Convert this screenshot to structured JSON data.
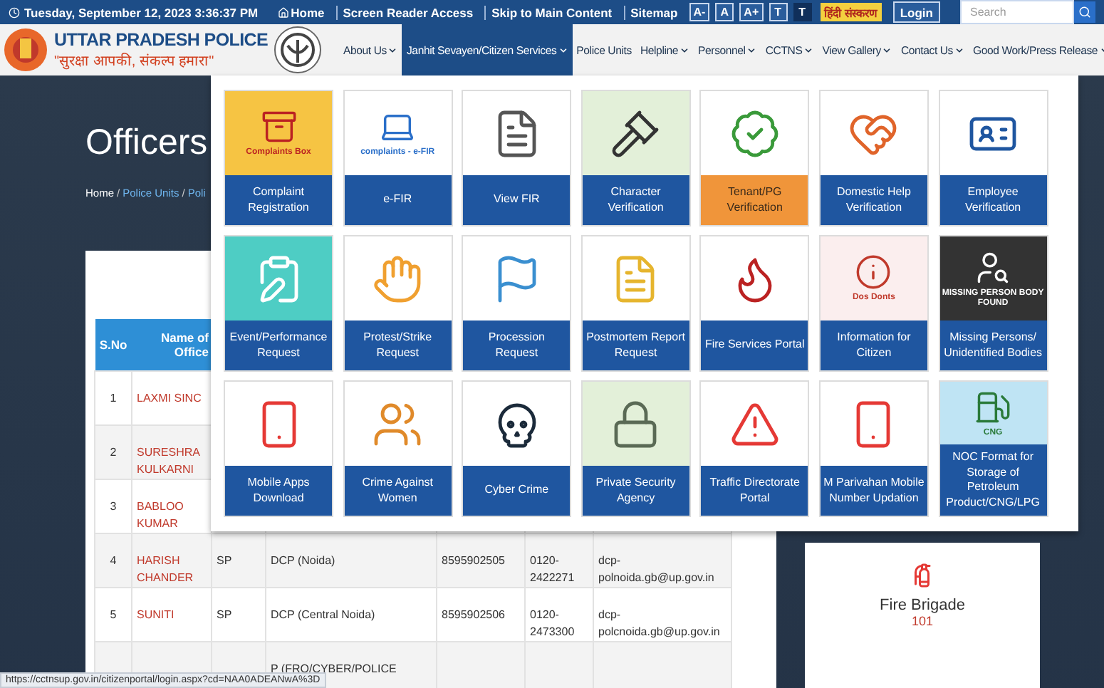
{
  "top_bar": {
    "datetime": "Tuesday, September 12, 2023 3:36:37 PM",
    "links": [
      {
        "label": "Home",
        "kind": "home"
      },
      {
        "label": "Screen Reader Access",
        "kind": "link"
      },
      {
        "label": "Skip to Main Content",
        "kind": "link"
      },
      {
        "label": "Sitemap",
        "kind": "link"
      }
    ],
    "font_buttons": [
      {
        "label": "A-",
        "selected": false
      },
      {
        "label": "A",
        "selected": false
      },
      {
        "label": "A+",
        "selected": false
      },
      {
        "label": "T",
        "selected": false
      },
      {
        "label": "T",
        "selected": true
      }
    ],
    "language_button": "हिंदी संस्करण",
    "login_button": "Login",
    "search": {
      "placeholder": "Search"
    }
  },
  "header": {
    "title": "UTTAR PRADESH POLICE",
    "slogan": "\"सुरक्षा आपकी, संकल्प हमारा\"",
    "nav": [
      {
        "label": "About Us",
        "dropdown": true,
        "selected": false
      },
      {
        "label": "Janhit Sevayen/Citizen Services",
        "dropdown": true,
        "selected": true
      },
      {
        "label": "Police Units",
        "dropdown": false,
        "selected": false
      },
      {
        "label": "Helpline",
        "dropdown": true,
        "selected": false
      },
      {
        "label": "Personnel",
        "dropdown": true,
        "selected": false
      },
      {
        "label": "CCTNS",
        "dropdown": true,
        "selected": false
      },
      {
        "label": "View Gallery",
        "dropdown": true,
        "selected": false
      },
      {
        "label": "Contact Us",
        "dropdown": true,
        "selected": false
      },
      {
        "label": "Good Work/Press Release",
        "dropdown": true,
        "selected": false
      }
    ]
  },
  "page": {
    "heading": "Officers",
    "breadcrumb": {
      "separator": "/",
      "items": [
        "Home",
        "Police Units",
        "Poli"
      ]
    },
    "table": {
      "columns": [
        "S.No",
        "Name of Office"
      ],
      "rows": [
        {
          "cells": [
            "1",
            "LAXMI SINC"
          ]
        },
        {
          "cells": [
            "2",
            "SURESHRA KULKARNI"
          ]
        },
        {
          "cells": [
            "3",
            "BABLOO KUMAR"
          ]
        },
        {
          "cells": [
            "4",
            "HARISH CHANDER",
            "SP",
            "DCP (Noida)",
            "8595902505",
            "0120-2422271",
            "dcp-polnoida.gb@up.gov.in"
          ]
        },
        {
          "cells": [
            "5",
            "SUNITI",
            "SP",
            "DCP (Central Noida)",
            "8595902506",
            "0120-2473300",
            "dcp-polcnoida.gb@up.gov.in"
          ]
        },
        {
          "cells": [
            "",
            "",
            "",
            "P (FRO/CYBER/POLICE"
          ]
        }
      ]
    },
    "helpline_card": {
      "title": "Fire Brigade",
      "number": "101"
    }
  },
  "dropdown_menu": {
    "tiles": [
      {
        "label": "Complaint Registration",
        "hovered": false,
        "picture_text": "Complaints Box"
      },
      {
        "label": "e-FIR",
        "hovered": false,
        "picture_text": "complaints - e-FIR"
      },
      {
        "label": "View FIR",
        "hovered": false
      },
      {
        "label": "Character Verification",
        "hovered": false
      },
      {
        "label": "Tenant/PG Verification",
        "hovered": true
      },
      {
        "label": "Domestic Help Verification",
        "hovered": false
      },
      {
        "label": "Employee Verification",
        "hovered": false
      },
      {
        "label": "Event/Performance Request",
        "hovered": false
      },
      {
        "label": "Protest/Strike Request",
        "hovered": false
      },
      {
        "label": "Procession Request",
        "hovered": false
      },
      {
        "label": "Postmortem Report Request",
        "hovered": false
      },
      {
        "label": "Fire Services Portal",
        "hovered": false
      },
      {
        "label": "Information for Citizen",
        "hovered": false,
        "picture_text": "Dos Donts"
      },
      {
        "label": "Missing Persons/ Unidentified Bodies",
        "hovered": false,
        "picture_text": "MISSING PERSON BODY FOUND"
      },
      {
        "label": "Mobile Apps Download",
        "hovered": false
      },
      {
        "label": "Crime Against Women",
        "hovered": false
      },
      {
        "label": "Cyber Crime",
        "hovered": false
      },
      {
        "label": "Private Security Agency",
        "hovered": false
      },
      {
        "label": "Traffic Directorate Portal",
        "hovered": false
      },
      {
        "label": "M Parivahan Mobile Number Updation",
        "hovered": false
      },
      {
        "label": "NOC Format for Storage of Petroleum Product/CNG/LPG",
        "hovered": false,
        "picture_text": "CNG"
      }
    ]
  },
  "status_bar": {
    "url": "https://cctnsup.gov.in/citizenportal/login.aspx?cd=NAA0ADEANwA%3D"
  }
}
